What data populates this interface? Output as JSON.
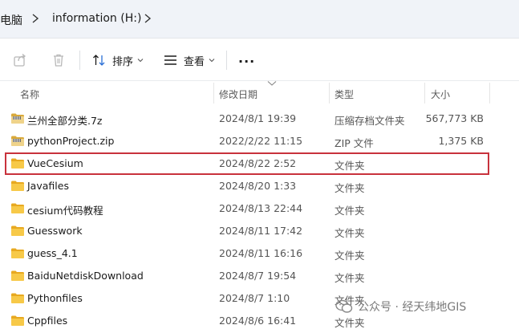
{
  "breadcrumb": {
    "items": [
      "电脑",
      "information (H:)"
    ]
  },
  "toolbar": {
    "sort_label": "排序",
    "view_label": "查看",
    "more_label": "..."
  },
  "columns": {
    "name": "名称",
    "modified": "修改日期",
    "type": "类型",
    "size": "大小"
  },
  "files": [
    {
      "icon": "zip-archive-icon",
      "name": "兰州全部分类.7z",
      "modified": "2024/8/1 19:39",
      "type": "压缩存档文件夹",
      "size": "567,773 KB"
    },
    {
      "icon": "zip-archive-icon",
      "name": "pythonProject.zip",
      "modified": "2022/2/22 11:15",
      "type": "ZIP 文件",
      "size": "1,375 KB"
    },
    {
      "icon": "folder-icon",
      "name": "VueCesium",
      "modified": "2024/8/22 2:52",
      "type": "文件夹",
      "size": "",
      "highlighted": true
    },
    {
      "icon": "folder-icon",
      "name": "Javafiles",
      "modified": "2024/8/20 1:33",
      "type": "文件夹",
      "size": ""
    },
    {
      "icon": "folder-icon",
      "name": "cesium代码教程",
      "modified": "2024/8/13 22:44",
      "type": "文件夹",
      "size": ""
    },
    {
      "icon": "folder-icon",
      "name": "Guesswork",
      "modified": "2024/8/11 17:42",
      "type": "文件夹",
      "size": ""
    },
    {
      "icon": "folder-icon",
      "name": "guess_4.1",
      "modified": "2024/8/11 16:16",
      "type": "文件夹",
      "size": ""
    },
    {
      "icon": "folder-icon",
      "name": "BaiduNetdiskDownload",
      "modified": "2024/8/7 19:54",
      "type": "文件夹",
      "size": ""
    },
    {
      "icon": "folder-icon",
      "name": "Pythonfiles",
      "modified": "2024/8/7 1:10",
      "type": "文件夹",
      "size": ""
    },
    {
      "icon": "folder-icon",
      "name": "Cppfiles",
      "modified": "2024/8/6 16:41",
      "type": "文件夹",
      "size": ""
    }
  ],
  "watermark": {
    "text": "公众号 · 经天纬地GIS"
  },
  "colors": {
    "folder": "#f7c948",
    "highlight_border": "#c8323c",
    "breadcrumb_bg": "#f0f3f8"
  }
}
